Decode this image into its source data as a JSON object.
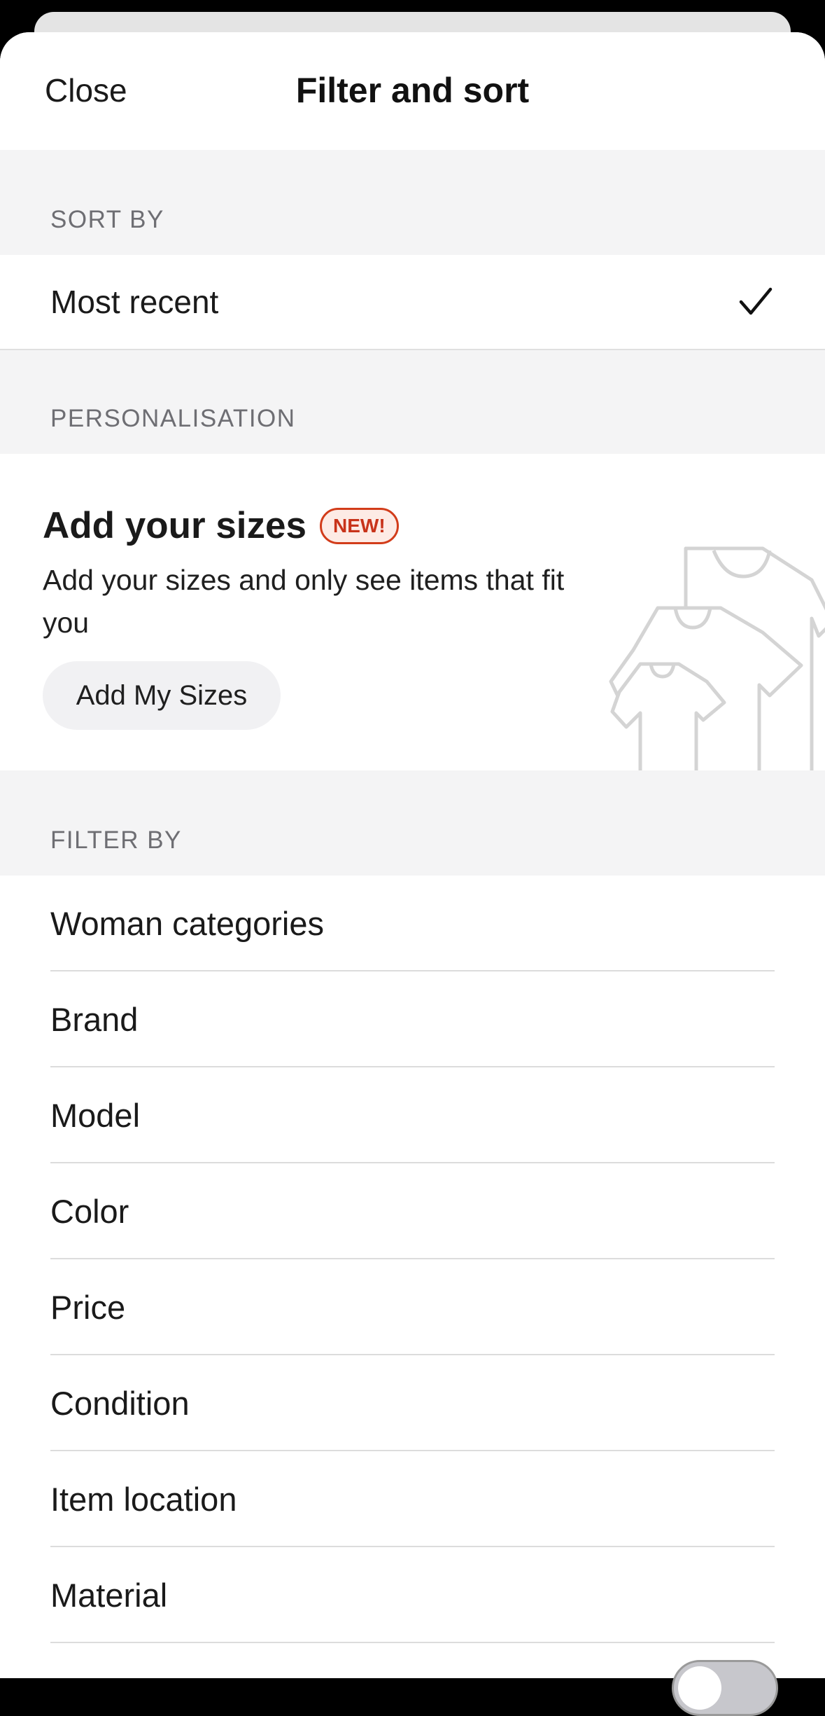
{
  "header": {
    "close_label": "Close",
    "title": "Filter and sort"
  },
  "sort": {
    "section_label": "SORT BY",
    "selected_option": "Most recent"
  },
  "personalisation": {
    "section_label": "PERSONALISATION",
    "title": "Add your sizes",
    "badge": "NEW!",
    "description": "Add your sizes and only see items that fit you",
    "button_label": "Add My Sizes"
  },
  "filter": {
    "section_label": "FILTER BY",
    "items": [
      {
        "label": "Woman categories"
      },
      {
        "label": "Brand"
      },
      {
        "label": "Model"
      },
      {
        "label": "Color"
      },
      {
        "label": "Price"
      },
      {
        "label": "Condition"
      },
      {
        "label": "Item location"
      },
      {
        "label": "Material"
      }
    ]
  },
  "colors": {
    "accent_badge": "#d23c1a",
    "section_background": "#f4f4f5",
    "text": "#1a1a1a"
  },
  "icons": {
    "selected_indicator": "checkmark-icon",
    "illustration": "tshirts-illustration"
  }
}
